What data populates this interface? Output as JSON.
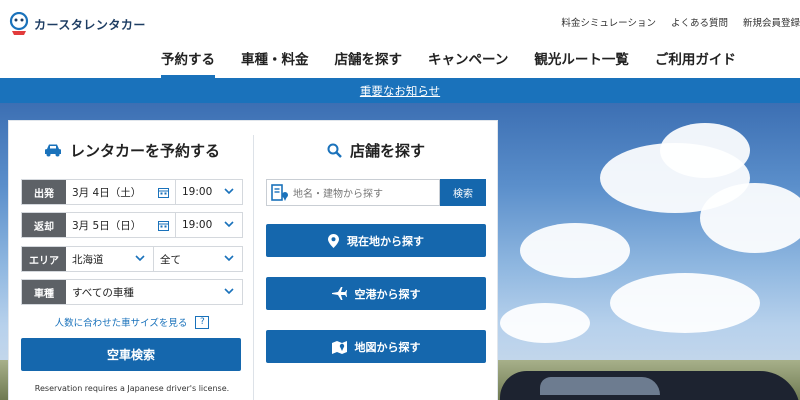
{
  "brand": {
    "name": "カースタレンタカー"
  },
  "header": {
    "utility_links": [
      "料金シミュレーション",
      "よくある質問",
      "新規会員登録"
    ],
    "nav": [
      {
        "label": "予約する",
        "active": true
      },
      {
        "label": "車種・料金",
        "active": false
      },
      {
        "label": "店舗を探す",
        "active": false
      },
      {
        "label": "キャンペーン",
        "active": false
      },
      {
        "label": "観光ルート一覧",
        "active": false
      },
      {
        "label": "ご利用ガイド",
        "active": false
      }
    ]
  },
  "notice": {
    "label": "重要なお知らせ"
  },
  "reserve": {
    "title": "レンタカーを予約する",
    "depart": {
      "label": "出発",
      "date": "3月 4日（土）",
      "time": "19:00"
    },
    "return": {
      "label": "返却",
      "date": "3月 5日（日）",
      "time": "19:00"
    },
    "area": {
      "label": "エリア",
      "region": "北海道",
      "sub": "全て"
    },
    "car": {
      "label": "車種",
      "value": "すべての車種"
    },
    "size_link": "人数に合わせた車サイズを見る",
    "help": "?",
    "search_button": "空車検索",
    "note": "Reservation requires a Japanese driver's license."
  },
  "store": {
    "title": "店舗を探す",
    "search_placeholder": "地名・建物から探す",
    "search_button": "検索",
    "current_location": "現在地から探す",
    "airport": "空港から探す",
    "map": "地図から探す"
  },
  "colors": {
    "primary": "#1567ad",
    "notice": "#1a72bb",
    "label_bg": "#5d6166"
  }
}
